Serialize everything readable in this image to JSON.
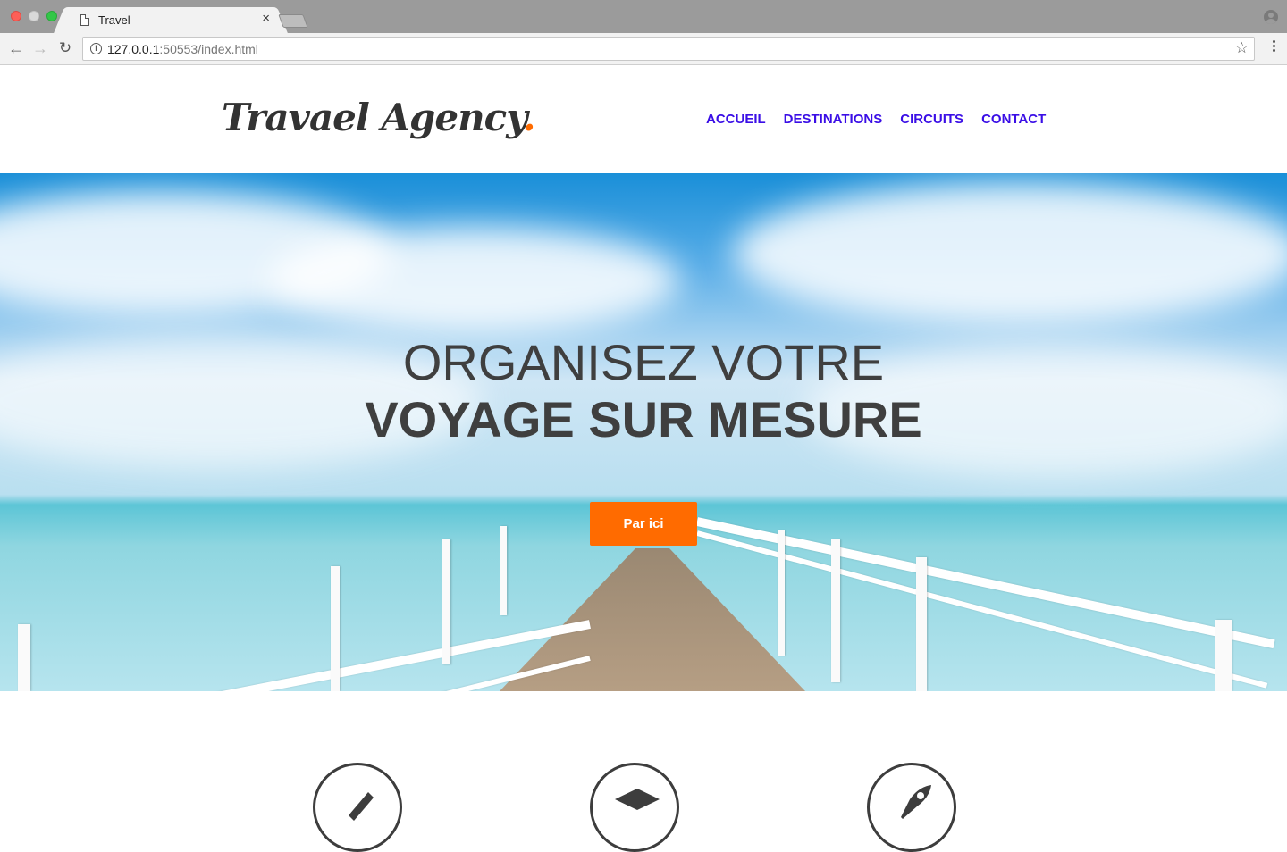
{
  "browser": {
    "tab_title": "Travel",
    "tab_close": "×",
    "url_host": "127.0.0.1",
    "url_rest": ":50553/index.html"
  },
  "site": {
    "logo_text": "Travael Agency",
    "logo_dot": ".",
    "nav": [
      "ACCUEIL",
      "DESTINATIONS",
      "CIRCUITS",
      "CONTACT"
    ],
    "hero_line1": "ORGANISEZ VOTRE",
    "hero_line2": "VOYAGE SUR MESURE",
    "cta_label": "Par ici"
  },
  "colors": {
    "accent": "#ff6b00",
    "nav_link": "#3a0ee6",
    "text_dark": "#3f3f3f"
  },
  "features": [
    "pencil-icon",
    "graduation-cap-icon",
    "rocket-icon"
  ]
}
